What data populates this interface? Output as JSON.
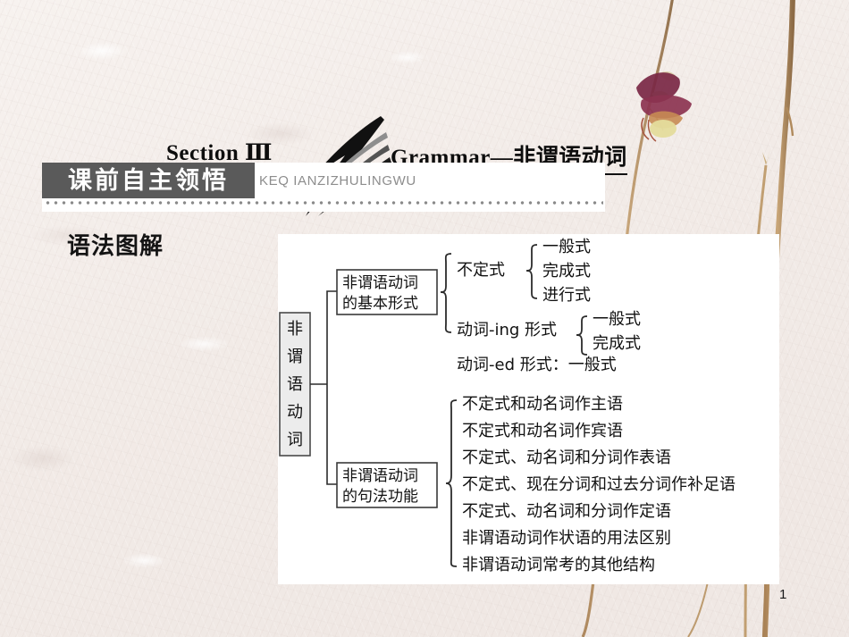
{
  "slide": {
    "page_number": "1",
    "background_color": "#f3ece9",
    "panel_color": "#ffffff"
  },
  "title": {
    "left": "Section Ⅲ",
    "right": "Grammar—非谓语动词",
    "decoration_icon": "swoosh-arrow-icon"
  },
  "banner": {
    "label": "课前自主领悟",
    "pinyin": "KEQ IANZIZHULINGWU",
    "tag_color": "#5a5a5a",
    "dots_color": "#8a8a8a"
  },
  "subheading": "语法图解",
  "chart_data": {
    "type": "diagram",
    "title": "语法图解",
    "root": "非谓语动词",
    "branches": [
      {
        "label": "非谓语动词\n的基本形式",
        "label_line1": "非谓语动词",
        "label_line2": "的基本形式",
        "children": [
          {
            "label": "不定式",
            "children": [
              "一般式",
              "完成式",
              "进行式"
            ]
          },
          {
            "label": "动词-ing 形式",
            "children": [
              "一般式",
              "完成式"
            ]
          },
          {
            "label": "动词-ed 形式：一般式",
            "children": []
          }
        ]
      },
      {
        "label": "非谓语动词\n的句法功能",
        "label_line1": "非谓语动词",
        "label_line2": "的句法功能",
        "children": [
          {
            "label": "不定式和动名词作主语",
            "children": []
          },
          {
            "label": "不定式和动名词作宾语",
            "children": []
          },
          {
            "label": "不定式、动名词和分词作表语",
            "children": []
          },
          {
            "label": "不定式、现在分词和过去分词作补足语",
            "children": []
          },
          {
            "label": "不定式、动名词和分词作定语",
            "children": []
          },
          {
            "label": "非谓语动词作状语的用法区别",
            "children": []
          },
          {
            "label": "非谓语动词常考的其他结构",
            "children": []
          }
        ]
      }
    ]
  },
  "diagram": {
    "root_chars": [
      "非",
      "谓",
      "语",
      "动",
      "词"
    ],
    "box1_line1": "非谓语动词",
    "box1_line2": "的基本形式",
    "box2_line1": "非谓语动词",
    "box2_line2": "的句法功能",
    "n_infinitive": "不定式",
    "n_inf_1": "一般式",
    "n_inf_2": "完成式",
    "n_inf_3": "进行式",
    "n_ing": "动词-ing 形式",
    "n_ing_1": "一般式",
    "n_ing_2": "完成式",
    "n_ed": "动词-ed 形式：一般式",
    "f1": "不定式和动名词作主语",
    "f2": "不定式和动名词作宾语",
    "f3": "不定式、动名词和分词作表语",
    "f4": "不定式、现在分词和过去分词作补足语",
    "f5": "不定式、动名词和分词作定语",
    "f6": "非谓语动词作状语的用法区别",
    "f7": "非谓语动词常考的其他结构"
  }
}
